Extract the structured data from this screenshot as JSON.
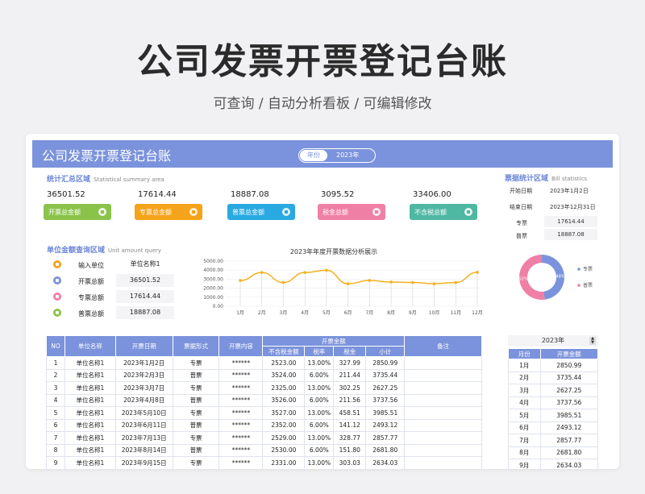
{
  "hero": {
    "title": "公司发票开票登记台账",
    "subtitle": "可查询 / 自动分析看板 / 可编辑修改"
  },
  "header": {
    "title": "公司发票开票登记台账",
    "year_label": "年份",
    "year_value": "2023年"
  },
  "summary": {
    "title": "统计汇总区域",
    "title_en": "Statistical summary area",
    "items": [
      {
        "value": "36501.52",
        "label": "开票总金额",
        "color": "#8bc34a"
      },
      {
        "value": "17614.44",
        "label": "专票总金额",
        "color": "#f5a31a"
      },
      {
        "value": "18887.08",
        "label": "普票总金额",
        "color": "#29a9e1"
      },
      {
        "value": "3095.52",
        "label": "税金总额",
        "color": "#f07fa6"
      },
      {
        "value": "33406.00",
        "label": "不含税总额",
        "color": "#4fb8a2"
      }
    ]
  },
  "bill_stats": {
    "title": "票据统计区域",
    "title_en": "Bill statistics",
    "start_label": "开始日期",
    "start_value": "2023年1月2日",
    "end_label": "结束日期",
    "end_value": "2023年12月31日",
    "special_label": "专票",
    "special_value": "17614.44",
    "normal_label": "普票",
    "normal_value": "18887.08",
    "pie": {
      "slices": [
        {
          "name": "专票",
          "percent": 48,
          "label": "48%",
          "color": "#7b93dc"
        },
        {
          "name": "普票",
          "percent": 52,
          "label": "52%",
          "color": "#f07fa6"
        }
      ]
    }
  },
  "unit_query": {
    "title": "单位金额查询区域",
    "title_en": "Unit amount query",
    "rows": [
      {
        "label": "输入单位",
        "value": "单位名称1",
        "color": "#f5a31a"
      },
      {
        "label": "开票总额",
        "value": "36501.52",
        "color": "#7b93dc"
      },
      {
        "label": "专票总额",
        "value": "17614.44",
        "color": "#f07fa6"
      },
      {
        "label": "普票总额",
        "value": "18887.08",
        "color": "#8bc34a"
      }
    ]
  },
  "chart_data": {
    "type": "line",
    "title": "2023年年度开票数据分析展示",
    "categories": [
      "1月",
      "2月",
      "3月",
      "4月",
      "5月",
      "6月",
      "7月",
      "8月",
      "9月",
      "10月",
      "11月",
      "12月"
    ],
    "values": [
      2850.99,
      3735.44,
      2627.25,
      3737.56,
      3985.51,
      2493.12,
      2857.77,
      2681.8,
      2634.03,
      2493.12,
      2634.03,
      3765.0
    ],
    "ylim": [
      0,
      5000
    ],
    "yticks": [
      "5000.00",
      "4000.00",
      "3000.00",
      "2000.00",
      "1000.00",
      "0.00"
    ],
    "color": "#f5b120"
  },
  "table": {
    "headers": {
      "no": "NO",
      "unit": "单位名称",
      "date": "开票日期",
      "form": "票据形式",
      "content": "开票内容",
      "amount": "开票金额",
      "pretax": "不含税金额",
      "rate": "税率",
      "tax": "税金",
      "subtotal": "小计",
      "note": "备注"
    },
    "rows": [
      [
        "1",
        "单位名称1",
        "2023年1月2日",
        "专票",
        "******",
        "2523.00",
        "13.00%",
        "327.99",
        "2850.99",
        ""
      ],
      [
        "2",
        "单位名称1",
        "2023年2月3日",
        "普票",
        "******",
        "3524.00",
        "6.00%",
        "211.44",
        "3735.44",
        ""
      ],
      [
        "3",
        "单位名称1",
        "2023年3月7日",
        "专票",
        "******",
        "2325.00",
        "13.00%",
        "302.25",
        "2627.25",
        ""
      ],
      [
        "4",
        "单位名称1",
        "2023年4月8日",
        "普票",
        "******",
        "3526.00",
        "6.00%",
        "211.56",
        "3737.56",
        ""
      ],
      [
        "5",
        "单位名称1",
        "2023年5月10日",
        "专票",
        "******",
        "3527.00",
        "13.00%",
        "458.51",
        "3985.51",
        ""
      ],
      [
        "6",
        "单位名称1",
        "2023年6月11日",
        "普票",
        "******",
        "2352.00",
        "6.00%",
        "141.12",
        "2493.12",
        ""
      ],
      [
        "7",
        "单位名称1",
        "2023年7月13日",
        "专票",
        "******",
        "2529.00",
        "13.00%",
        "328.77",
        "2857.77",
        ""
      ],
      [
        "8",
        "单位名称1",
        "2023年8月14日",
        "普票",
        "******",
        "2530.00",
        "6.00%",
        "151.80",
        "2681.80",
        ""
      ],
      [
        "9",
        "单位名称1",
        "2023年9月15日",
        "专票",
        "******",
        "2331.00",
        "13.00%",
        "303.03",
        "2634.03",
        ""
      ]
    ]
  },
  "monthly": {
    "year": "2023年",
    "header_month": "月份",
    "header_amount": "开票金额",
    "rows": [
      [
        "1月",
        "2850.99"
      ],
      [
        "2月",
        "3735.44"
      ],
      [
        "3月",
        "2627.25"
      ],
      [
        "4月",
        "3737.56"
      ],
      [
        "5月",
        "3985.51"
      ],
      [
        "6月",
        "2493.12"
      ],
      [
        "7月",
        "2857.77"
      ],
      [
        "8月",
        "2681.80"
      ],
      [
        "9月",
        "2634.03"
      ]
    ]
  }
}
